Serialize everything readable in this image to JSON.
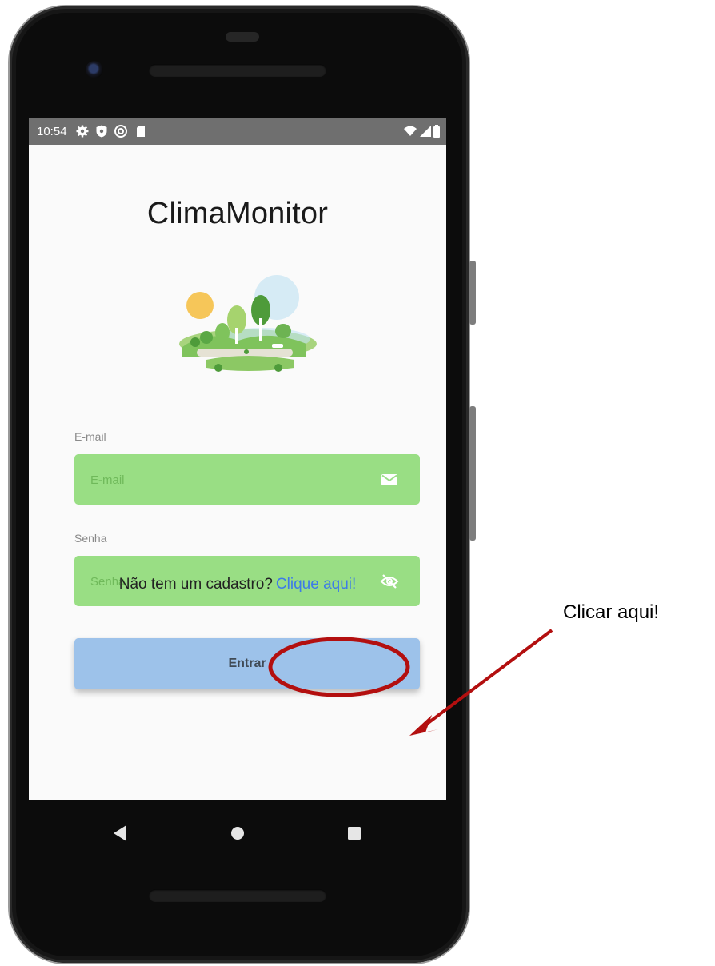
{
  "status_bar": {
    "time": "10:54",
    "left_icons": [
      "settings-icon",
      "shield-icon",
      "at-sign-icon",
      "sd-card-icon"
    ],
    "right_icons": [
      "wifi-icon",
      "signal-icon",
      "battery-icon"
    ]
  },
  "app": {
    "title": "ClimaMonitor",
    "illustration": "park-landscape-illustration"
  },
  "form": {
    "email": {
      "label": "E-mail",
      "placeholder": "E-mail",
      "value": "",
      "icon": "envelope-icon"
    },
    "password": {
      "label": "Senha",
      "placeholder": "Senha",
      "value": "",
      "icon": "eye-off-icon"
    },
    "submit_label": "Entrar"
  },
  "signup": {
    "prompt": "Não tem um cadastro?",
    "link": "Clique aqui!"
  },
  "nav_bar": [
    "back-icon",
    "home-icon",
    "recents-icon"
  ],
  "annotation": {
    "text": "Clicar aqui!",
    "color": "#b30f0f"
  },
  "colors": {
    "field_bg": "#99de84",
    "button_bg": "#9dc2ea",
    "link": "#3d7be8",
    "status_bar": "#6f6f6f"
  }
}
